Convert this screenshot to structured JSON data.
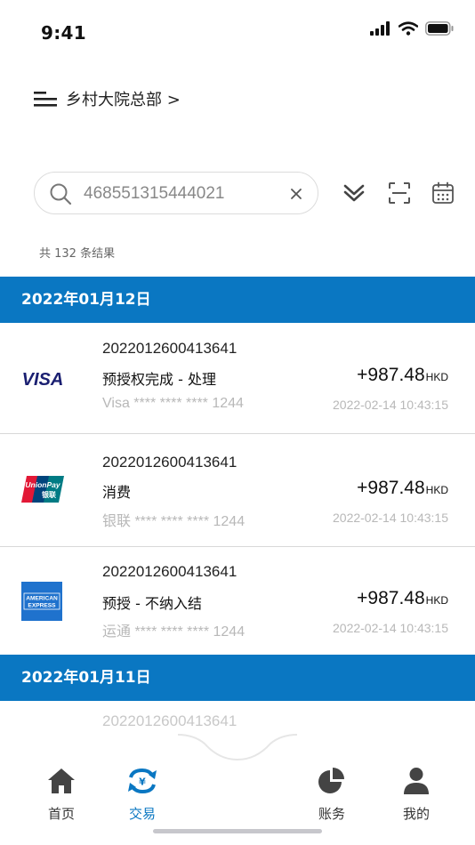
{
  "status_bar": {
    "time": "9:41"
  },
  "header": {
    "title": "乡村大院总部 >",
    "menu_icon": "menu-lines-icon"
  },
  "search": {
    "value": "468551315444021",
    "placeholder": ""
  },
  "toolbar": {
    "filter_icon": "double-chevron-down-icon",
    "scan_icon": "scan-icon",
    "calendar_icon": "calendar-icon"
  },
  "results": {
    "count_text": "共 132 条结果"
  },
  "groups": [
    {
      "date": "2022年01月12日",
      "transactions": [
        {
          "id": "2022012600413641",
          "type": "预授权完成 - 处理",
          "card": "Visa **** **** **** 1244",
          "amount": "+987.48",
          "currency": "HKD",
          "time": "2022-02-14 10:43:15",
          "brand": "visa"
        },
        {
          "id": "2022012600413641",
          "type": "消费",
          "card": "银联 **** **** **** 1244",
          "amount": "+987.48",
          "currency": "HKD",
          "time": "2022-02-14 10:43:15",
          "brand": "unionpay"
        },
        {
          "id": "2022012600413641",
          "type": "预授 - 不纳入结",
          "card": "运通 **** **** **** 1244",
          "amount": "+987.48",
          "currency": "HKD",
          "time": "2022-02-14 10:43:15",
          "brand": "amex"
        }
      ]
    },
    {
      "date": "2022年01月11日",
      "transactions": [
        {
          "id": "2022012600413641"
        }
      ]
    }
  ],
  "brands": {
    "visa": "VISA",
    "unionpay_top": "UnionPay",
    "unionpay_bottom": "银联",
    "amex_top": "AMERICAN",
    "amex_bottom": "EXPRESS"
  },
  "tabs": [
    {
      "label": "首页",
      "icon": "home-icon",
      "active": false
    },
    {
      "label": "交易",
      "icon": "exchange-icon",
      "active": true
    },
    {
      "label": "账务",
      "icon": "pie-chart-icon",
      "active": false
    },
    {
      "label": "我的",
      "icon": "user-icon",
      "active": false
    }
  ],
  "colors": {
    "accent": "#0a77c2",
    "text": "#111111",
    "muted": "#b8b8b8"
  }
}
